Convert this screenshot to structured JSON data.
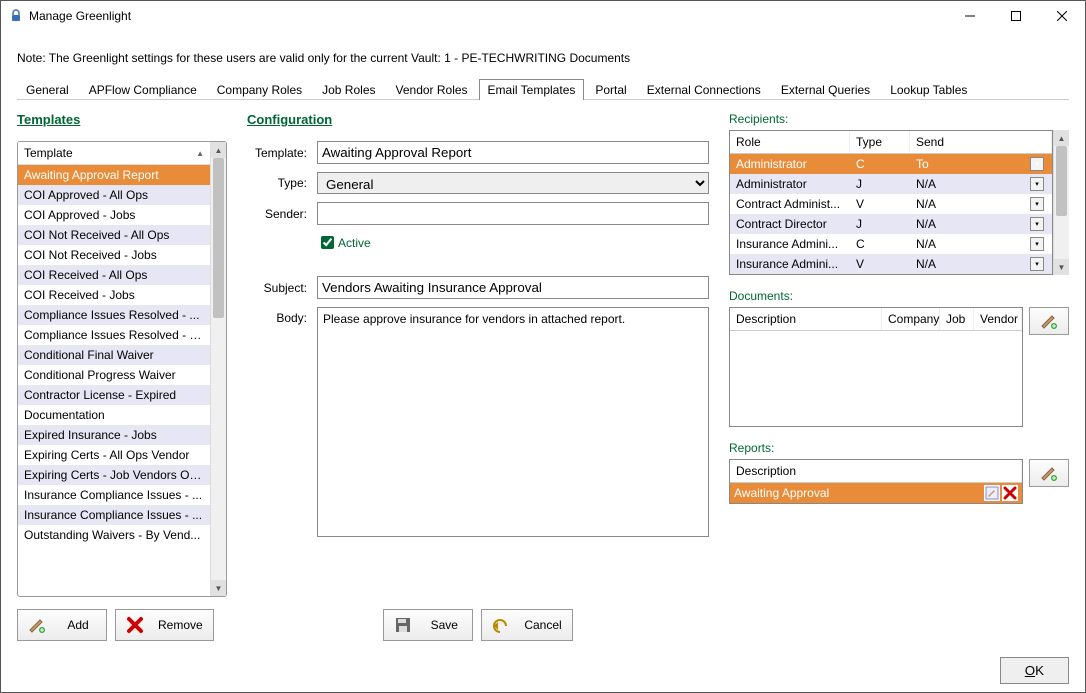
{
  "window": {
    "title": "Manage Greenlight"
  },
  "note": "Note:  The Greenlight settings for these users are valid only for the current Vault: 1 - PE-TECHWRITING Documents",
  "tabs": {
    "items": [
      "General",
      "APFlow Compliance",
      "Company Roles",
      "Job Roles",
      "Vendor Roles",
      "Email Templates",
      "Portal",
      "External Connections",
      "External Queries",
      "Lookup Tables"
    ],
    "active": "Email Templates"
  },
  "templates": {
    "heading": "Templates",
    "column": "Template",
    "items": [
      {
        "label": "Awaiting Approval Report",
        "sel": true
      },
      {
        "label": "COI Approved - All Ops",
        "alt": true
      },
      {
        "label": "COI Approved - Jobs"
      },
      {
        "label": "COI Not Received - All Ops",
        "alt": true
      },
      {
        "label": "COI Not Received - Jobs"
      },
      {
        "label": "COI Received - All Ops",
        "alt": true
      },
      {
        "label": "COI Received - Jobs"
      },
      {
        "label": "Compliance Issues Resolved - ...",
        "alt": true
      },
      {
        "label": "Compliance Issues Resolved - J..."
      },
      {
        "label": "Conditional Final Waiver",
        "alt": true
      },
      {
        "label": "Conditional Progress Waiver"
      },
      {
        "label": "Contractor License - Expired",
        "alt": true
      },
      {
        "label": "Documentation"
      },
      {
        "label": "Expired Insurance - Jobs",
        "alt": true
      },
      {
        "label": "Expiring Certs - All Ops Vendor"
      },
      {
        "label": "Expiring Certs - Job Vendors Only",
        "alt": true
      },
      {
        "label": "Insurance Compliance Issues - ..."
      },
      {
        "label": "Insurance Compliance Issues - ...",
        "alt": true
      },
      {
        "label": "Outstanding Waivers - By Vend..."
      }
    ],
    "add_label": "Add",
    "remove_label": "Remove"
  },
  "config": {
    "heading": "Configuration",
    "labels": {
      "template": "Template:",
      "type": "Type:",
      "sender": "Sender:",
      "active": "Active",
      "subject": "Subject:",
      "body": "Body:"
    },
    "template_value": "Awaiting Approval Report",
    "type_value": "General",
    "sender_value": "",
    "active_checked": true,
    "subject_value": "Vendors Awaiting Insurance Approval",
    "body_value": "Please approve insurance for vendors in attached report.",
    "save_label": "Save",
    "cancel_label": "Cancel"
  },
  "recipients": {
    "heading": "Recipients:",
    "cols": {
      "role": "Role",
      "type": "Type",
      "send": "Send"
    },
    "rows": [
      {
        "role": "Administrator",
        "type": "C",
        "send": "To",
        "sel": true
      },
      {
        "role": "Administrator",
        "type": "J",
        "send": "N/A",
        "alt": true
      },
      {
        "role": "Contract Administ...",
        "type": "V",
        "send": "N/A"
      },
      {
        "role": "Contract Director",
        "type": "J",
        "send": "N/A",
        "alt": true
      },
      {
        "role": "Insurance Admini...",
        "type": "C",
        "send": "N/A"
      },
      {
        "role": "Insurance Admini...",
        "type": "V",
        "send": "N/A",
        "alt": true
      }
    ]
  },
  "documents": {
    "heading": "Documents:",
    "cols": {
      "desc": "Description",
      "company": "Company",
      "job": "Job",
      "vendor": "Vendor"
    }
  },
  "reports": {
    "heading": "Reports:",
    "col": "Description",
    "row": "Awaiting Approval"
  },
  "ok_label": "OK"
}
